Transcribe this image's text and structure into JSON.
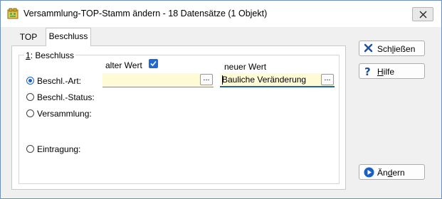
{
  "window": {
    "title": "Versammlung-TOP-Stamm ändern - 18 Datensätze (1 Objekt)"
  },
  "tabs": [
    {
      "label": "TOP"
    },
    {
      "label": "Beschluss"
    }
  ],
  "group": {
    "mnemonic": "1",
    "label_rest": ": Beschluss"
  },
  "columns": {
    "old_label": "alter Wert",
    "old_checked": true,
    "new_label": "neuer Wert"
  },
  "radios": [
    {
      "label": "Beschl.-Art:",
      "checked": true
    },
    {
      "label": "Beschl.-Status:",
      "checked": false
    },
    {
      "label": "Versammlung:",
      "checked": false
    },
    {
      "label": "Eintragung:",
      "checked": false
    }
  ],
  "fields": {
    "old_value": "",
    "new_value": "Bauliche Veränderung",
    "browse_label": "..."
  },
  "buttons": {
    "close": {
      "pre": "Sch",
      "mnemonic": "l",
      "post": "ießen"
    },
    "help": {
      "pre": "",
      "mnemonic": "H",
      "post": "ilfe"
    },
    "change": {
      "pre": "Än",
      "mnemonic": "d",
      "post": "ern"
    }
  },
  "colors": {
    "accent": "#1c5fc4",
    "field_bg": "#fffbd6"
  }
}
